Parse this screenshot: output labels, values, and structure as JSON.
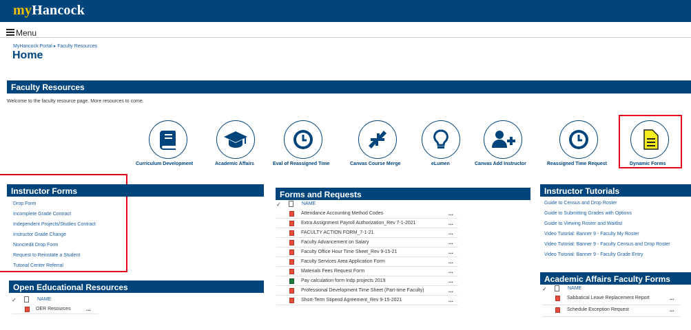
{
  "header": {
    "logo_my": "my",
    "logo_name": "Hancock"
  },
  "menu": {
    "label": "Menu",
    "icon": "hamburger-icon"
  },
  "breadcrumb": "MyHancock Portal ▸ Faculty Resources",
  "page_title": "Home",
  "faculty_resources": {
    "title": "Faculty Resources",
    "welcome": "Welcome to the faculty resource page. More resources to come.",
    "tiles": [
      {
        "label": "Curriculum Development",
        "icon": "book-icon"
      },
      {
        "label": "Academic Affairs",
        "icon": "graduation-cap-icon"
      },
      {
        "label": "Eval of Reassigned Time",
        "icon": "clock-icon"
      },
      {
        "label": "Canvas Course Merge",
        "icon": "compress-arrows-icon"
      },
      {
        "label": "eLumen",
        "icon": "lightbulb-icon"
      },
      {
        "label": "Canvas Add Instructor",
        "icon": "user-plus-icon"
      },
      {
        "label": "Reassigned Time Request",
        "icon": "clock-icon"
      },
      {
        "label": "Dynamic Forms",
        "icon": "document-icon"
      }
    ]
  },
  "instructor_forms": {
    "title": "Instructor Forms",
    "links": [
      "Drop Form",
      "Incomplete Grade Contract",
      "Independent Projects/Studies Contract",
      "Instructor Grade Change",
      "Noncredit Drop Form",
      "Request to Reinstate a Student",
      "Tutorial Center Referral"
    ]
  },
  "oer": {
    "title": "Open Educational Resources",
    "column": "NAME",
    "items": [
      {
        "name": "OER Resources",
        "more": "..."
      }
    ]
  },
  "forms_requests": {
    "title": "Forms and Requests",
    "column": "NAME",
    "items": [
      {
        "name": "Attendance Accounting Method Codes",
        "type": "pdf",
        "more": "..."
      },
      {
        "name": "Extra Assignment Payroll Authorization_Rev 7-1-2021",
        "type": "pdf",
        "more": "..."
      },
      {
        "name": "FACULTY ACTION FORM_7-1-21",
        "type": "pdf",
        "more": "..."
      },
      {
        "name": "Faculty Advancement on Salary",
        "type": "pdf",
        "more": "..."
      },
      {
        "name": "Faculty Office Hour Time Sheet_Rev 9-15-21",
        "type": "pdf",
        "more": "..."
      },
      {
        "name": "Faculty Services Area Application Form",
        "type": "pdf",
        "more": "..."
      },
      {
        "name": "Materials Fees Request Form",
        "type": "pdf",
        "more": "..."
      },
      {
        "name": "Pay calculation form Indp projects 2019",
        "type": "xls",
        "more": "..."
      },
      {
        "name": "Professional Development Time Sheet (Part-time Faculty)",
        "type": "pdf",
        "more": "..."
      },
      {
        "name": "Short-Term Stipend Agreement_Rev 9-15-2021",
        "type": "pdf",
        "more": "..."
      }
    ]
  },
  "tutorials": {
    "title": "Instructor Tutorials",
    "links": [
      "Guide to Census and Drop Roster",
      "Guide to Submitting Grades with Options",
      "Guide to Viewing Roster and Waitlist",
      "Video Tutorial: Banner 9 - Faculty My Roster",
      "Video Tutorial: Banner 9 - Faculty Census and Drop Roster",
      "Video Tutorial: Banner 9 - Faculty Grade Entry"
    ]
  },
  "academic_affairs_forms": {
    "title": "Academic Affairs Faculty Forms",
    "column": "NAME",
    "items": [
      {
        "name": "Sabbatical Leave Replacement Report",
        "more": "..."
      },
      {
        "name": "Schedule Exception Request",
        "more": "..."
      }
    ]
  },
  "colors": {
    "brand": "#00447c",
    "logo_accent": "#f2c200",
    "highlight": "#e3001b",
    "link": "#1a5da8",
    "dynamic_forms_icon": "#f4ec1c"
  }
}
